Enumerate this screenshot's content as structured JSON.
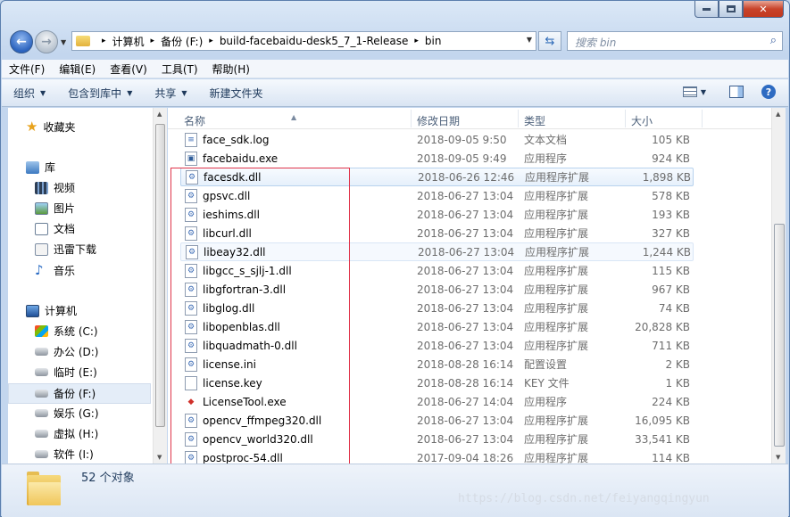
{
  "window": {
    "min_glyph": "–",
    "max_glyph": "□",
    "close_glyph": "✕"
  },
  "address": {
    "crumbs": [
      "计算机",
      "备份 (F:)",
      "build-facebaidu-desk5_7_1-Release",
      "bin"
    ],
    "separator": "▸"
  },
  "search": {
    "placeholder": "搜索 bin"
  },
  "menu": [
    "文件(F)",
    "编辑(E)",
    "查看(V)",
    "工具(T)",
    "帮助(H)"
  ],
  "toolbar": {
    "organize": "组织",
    "include_library": "包含到库中",
    "share": "共享",
    "new_folder": "新建文件夹"
  },
  "sidebar": {
    "favorites": "收藏夹",
    "libraries": "库",
    "library_items": [
      "视频",
      "图片",
      "文档",
      "迅雷下载",
      "音乐"
    ],
    "computer": "计算机",
    "drives": [
      "系统 (C:)",
      "办公 (D:)",
      "临时 (E:)",
      "备份 (F:)",
      "娱乐 (G:)",
      "虚拟 (H:)",
      "软件 (I:)"
    ]
  },
  "columns": {
    "name": "名称",
    "date": "修改日期",
    "type": "类型",
    "size": "大小"
  },
  "files": [
    {
      "name": "face_sdk.log",
      "date": "2018-09-05 9:50",
      "type": "文本文档",
      "size": "105 KB",
      "icon": "text-file-icon"
    },
    {
      "name": "facebaidu.exe",
      "date": "2018-09-05 9:49",
      "type": "应用程序",
      "size": "924 KB",
      "icon": "exe-icon"
    },
    {
      "name": "facesdk.dll",
      "date": "2018-06-26 12:46",
      "type": "应用程序扩展",
      "size": "1,898 KB",
      "icon": "dll-icon"
    },
    {
      "name": "gpsvc.dll",
      "date": "2018-06-27 13:04",
      "type": "应用程序扩展",
      "size": "578 KB",
      "icon": "dll-icon"
    },
    {
      "name": "ieshims.dll",
      "date": "2018-06-27 13:04",
      "type": "应用程序扩展",
      "size": "193 KB",
      "icon": "dll-icon"
    },
    {
      "name": "libcurl.dll",
      "date": "2018-06-27 13:04",
      "type": "应用程序扩展",
      "size": "327 KB",
      "icon": "dll-icon"
    },
    {
      "name": "libeay32.dll",
      "date": "2018-06-27 13:04",
      "type": "应用程序扩展",
      "size": "1,244 KB",
      "icon": "dll-icon"
    },
    {
      "name": "libgcc_s_sjlj-1.dll",
      "date": "2018-06-27 13:04",
      "type": "应用程序扩展",
      "size": "115 KB",
      "icon": "dll-icon"
    },
    {
      "name": "libgfortran-3.dll",
      "date": "2018-06-27 13:04",
      "type": "应用程序扩展",
      "size": "967 KB",
      "icon": "dll-icon"
    },
    {
      "name": "libglog.dll",
      "date": "2018-06-27 13:04",
      "type": "应用程序扩展",
      "size": "74 KB",
      "icon": "dll-icon"
    },
    {
      "name": "libopenblas.dll",
      "date": "2018-06-27 13:04",
      "type": "应用程序扩展",
      "size": "20,828 KB",
      "icon": "dll-icon"
    },
    {
      "name": "libquadmath-0.dll",
      "date": "2018-06-27 13:04",
      "type": "应用程序扩展",
      "size": "711 KB",
      "icon": "dll-icon"
    },
    {
      "name": "license.ini",
      "date": "2018-08-28 16:14",
      "type": "配置设置",
      "size": "2 KB",
      "icon": "config-file-icon"
    },
    {
      "name": "license.key",
      "date": "2018-08-28 16:14",
      "type": "KEY 文件",
      "size": "1 KB",
      "icon": "blank-file-icon"
    },
    {
      "name": "LicenseTool.exe",
      "date": "2018-06-27 14:04",
      "type": "应用程序",
      "size": "224 KB",
      "icon": "app-exe-icon"
    },
    {
      "name": "opencv_ffmpeg320.dll",
      "date": "2018-06-27 13:04",
      "type": "应用程序扩展",
      "size": "16,095 KB",
      "icon": "dll-icon"
    },
    {
      "name": "opencv_world320.dll",
      "date": "2018-06-27 13:04",
      "type": "应用程序扩展",
      "size": "33,541 KB",
      "icon": "dll-icon"
    },
    {
      "name": "postproc-54.dll",
      "date": "2017-09-04 18:26",
      "type": "应用程序扩展",
      "size": "114 KB",
      "icon": "dll-icon"
    }
  ],
  "status": {
    "count": "52 个对象"
  },
  "watermark": "https://blog.csdn.net/feiyangqingyun",
  "colors": {
    "accent": "#1e395b",
    "highlight_box": "#e0344b",
    "selection": "#e6f0fb"
  }
}
